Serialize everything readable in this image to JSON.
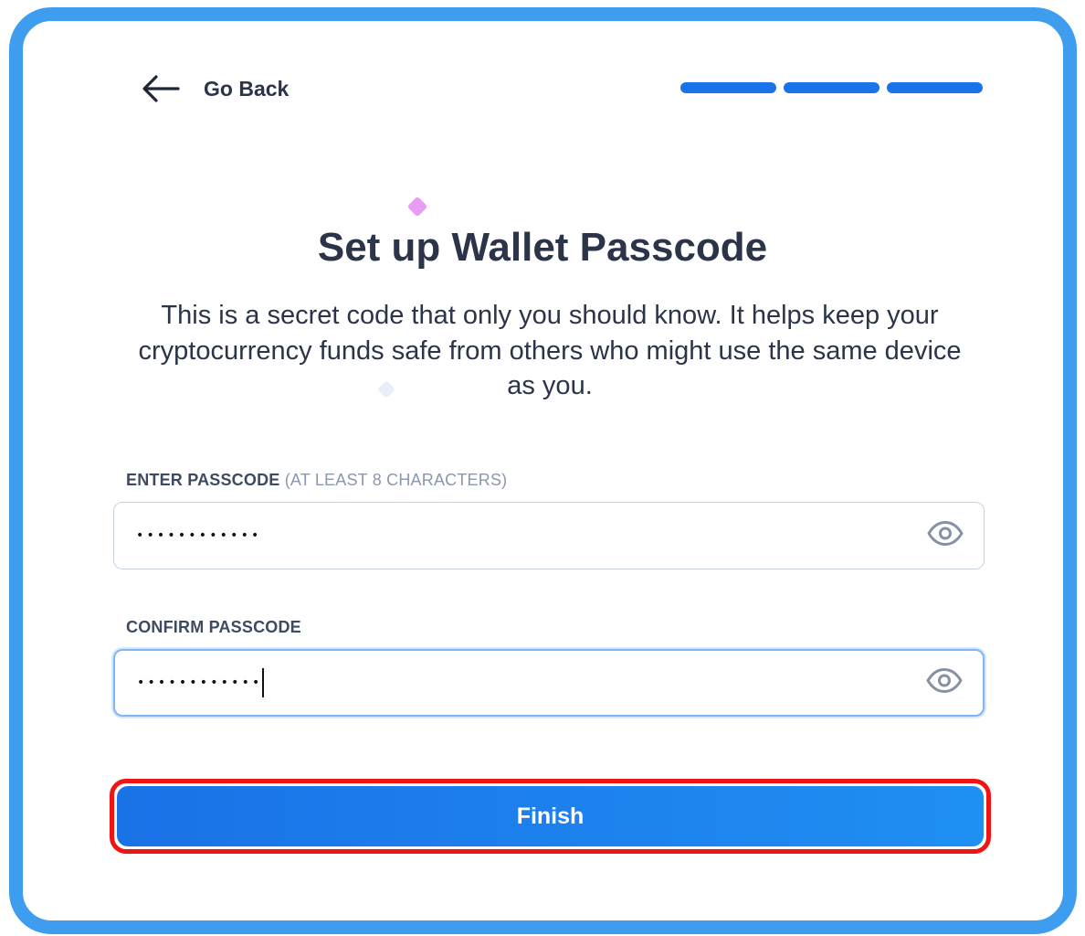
{
  "nav": {
    "back_label": "Go Back",
    "progress_steps_total": 3,
    "progress_steps_completed": 3
  },
  "header": {
    "title": "Set up Wallet Passcode",
    "description": "This is a secret code that only you should know. It helps keep your cryptocurrency funds safe from others who might use the same device as you."
  },
  "form": {
    "passcode": {
      "label": "ENTER PASSCODE",
      "hint": "(AT LEAST 8 CHARACTERS)",
      "masked_value": "••••••••••••"
    },
    "confirm": {
      "label": "CONFIRM PASSCODE",
      "masked_value": "••••••••••••"
    },
    "submit_label": "Finish"
  },
  "colors": {
    "frame_border": "#3f9df0",
    "accent": "#1a73e8",
    "text_primary": "#2b3448",
    "highlight_outline": "#f01414"
  }
}
